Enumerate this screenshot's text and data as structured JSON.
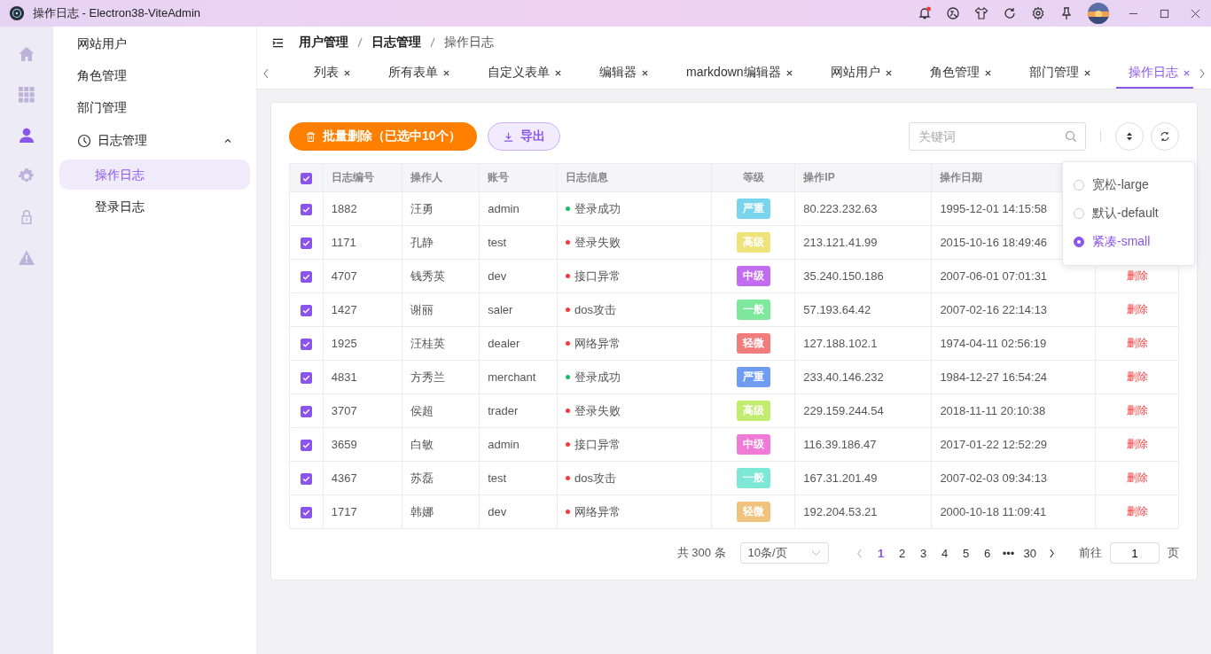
{
  "window": {
    "title": "操作日志 - Electron38-ViteAdmin"
  },
  "rail": [
    {
      "kind": "home",
      "selected": false
    },
    {
      "kind": "grid",
      "selected": false
    },
    {
      "kind": "user",
      "selected": true
    },
    {
      "kind": "gear",
      "selected": false
    },
    {
      "kind": "lock",
      "selected": false
    },
    {
      "kind": "warning",
      "selected": false
    }
  ],
  "sidebar": {
    "items": [
      {
        "label": "网站用户",
        "selected": false
      },
      {
        "label": "角色管理",
        "selected": false
      },
      {
        "label": "部门管理",
        "selected": false
      },
      {
        "label": "日志管理",
        "expanded": true,
        "children": [
          {
            "label": "操作日志",
            "selected": true
          },
          {
            "label": "登录日志",
            "selected": false
          }
        ]
      }
    ]
  },
  "breadcrumb": [
    "用户管理",
    "日志管理",
    "操作日志"
  ],
  "tabs": [
    {
      "label": "列表",
      "selected": false
    },
    {
      "label": "所有表单",
      "selected": false
    },
    {
      "label": "自定义表单",
      "selected": false
    },
    {
      "label": "编辑器",
      "selected": false
    },
    {
      "label": "markdown编辑器",
      "selected": false
    },
    {
      "label": "网站用户",
      "selected": false
    },
    {
      "label": "角色管理",
      "selected": false
    },
    {
      "label": "部门管理",
      "selected": false
    },
    {
      "label": "操作日志",
      "selected": true
    }
  ],
  "toolbar": {
    "batch_delete": "批量删除（已选中10个）",
    "export": "导出",
    "search": {
      "placeholder": "关键词"
    }
  },
  "size_menu": [
    {
      "label": "宽松-large",
      "selected": false
    },
    {
      "label": "默认-default",
      "selected": false
    },
    {
      "label": "紧凑-small",
      "selected": true
    }
  ],
  "table": {
    "all_checked": true,
    "columns": [
      "日志编号",
      "操作人",
      "账号",
      "日志信息",
      "等级",
      "操作IP",
      "操作日期"
    ],
    "rows": [
      {
        "checked": true,
        "id": "1882",
        "operator": "汪勇",
        "account": "admin",
        "status": {
          "label": "登录成功",
          "color": "#19be6b"
        },
        "grade": {
          "label": "严重",
          "color": "#79d5ee"
        },
        "ip": "80.223.232.63",
        "date": "1995-12-01 14:15:58"
      },
      {
        "checked": true,
        "id": "1171",
        "operator": "孔静",
        "account": "test",
        "status": {
          "label": "登录失败",
          "color": "#f03c3c"
        },
        "grade": {
          "label": "高级",
          "color": "#eee27a"
        },
        "ip": "213.121.41.99",
        "date": "2015-10-16 18:49:46"
      },
      {
        "checked": true,
        "id": "4707",
        "operator": "钱秀英",
        "account": "dev",
        "status": {
          "label": "接口异常",
          "color": "#f03c3c"
        },
        "grade": {
          "label": "中级",
          "color": "#c26cf0"
        },
        "ip": "35.240.150.186",
        "date": "2007-06-01 07:01:31",
        "action": "删除"
      },
      {
        "checked": true,
        "id": "1427",
        "operator": "谢丽",
        "account": "saler",
        "status": {
          "label": "dos攻击",
          "color": "#f03c3c"
        },
        "grade": {
          "label": "一般",
          "color": "#7ee89c"
        },
        "ip": "57.193.64.42",
        "date": "2007-02-16 22:14:13",
        "action": "删除"
      },
      {
        "checked": true,
        "id": "1925",
        "operator": "汪桂英",
        "account": "dealer",
        "status": {
          "label": "网络异常",
          "color": "#f03c3c"
        },
        "grade": {
          "label": "轻微",
          "color": "#f07c7c"
        },
        "ip": "127.188.102.1",
        "date": "1974-04-11 02:56:19",
        "action": "删除"
      },
      {
        "checked": true,
        "id": "4831",
        "operator": "方秀兰",
        "account": "merchant",
        "status": {
          "label": "登录成功",
          "color": "#19be6b"
        },
        "grade": {
          "label": "严重",
          "color": "#6f9bf0"
        },
        "ip": "233.40.146.232",
        "date": "1984-12-27 16:54:24",
        "action": "删除"
      },
      {
        "checked": true,
        "id": "3707",
        "operator": "侯超",
        "account": "trader",
        "status": {
          "label": "登录失败",
          "color": "#f03c3c"
        },
        "grade": {
          "label": "高级",
          "color": "#c2ec6e"
        },
        "ip": "229.159.244.54",
        "date": "2018-11-11 20:10:38",
        "action": "删除"
      },
      {
        "checked": true,
        "id": "3659",
        "operator": "白敏",
        "account": "admin",
        "status": {
          "label": "接口异常",
          "color": "#f03c3c"
        },
        "grade": {
          "label": "中级",
          "color": "#f07ad6"
        },
        "ip": "116.39.186.47",
        "date": "2017-01-22 12:52:29",
        "action": "删除"
      },
      {
        "checked": true,
        "id": "4367",
        "operator": "苏磊",
        "account": "test",
        "status": {
          "label": "dos攻击",
          "color": "#f03c3c"
        },
        "grade": {
          "label": "一般",
          "color": "#7ee8d6"
        },
        "ip": "167.31.201.49",
        "date": "2007-02-03 09:34:13",
        "action": "删除"
      },
      {
        "checked": true,
        "id": "1717",
        "operator": "韩娜",
        "account": "dev",
        "status": {
          "label": "网络异常",
          "color": "#f03c3c"
        },
        "grade": {
          "label": "轻微",
          "color": "#f0c27c"
        },
        "ip": "192.204.53.21",
        "date": "2000-10-18 11:09:41",
        "action": "删除"
      }
    ]
  },
  "pagination": {
    "total": "共 300 条",
    "page_size": "10条/页",
    "pages": [
      {
        "label": "1",
        "selected": true
      },
      {
        "label": "2",
        "selected": false
      },
      {
        "label": "3",
        "selected": false
      },
      {
        "label": "4",
        "selected": false
      },
      {
        "label": "5",
        "selected": false
      },
      {
        "label": "6",
        "selected": false
      },
      {
        "label": "•••",
        "selected": false
      },
      {
        "label": "30",
        "selected": false
      }
    ],
    "goto_label": "前往",
    "goto_value": "1",
    "page_unit": "页"
  }
}
